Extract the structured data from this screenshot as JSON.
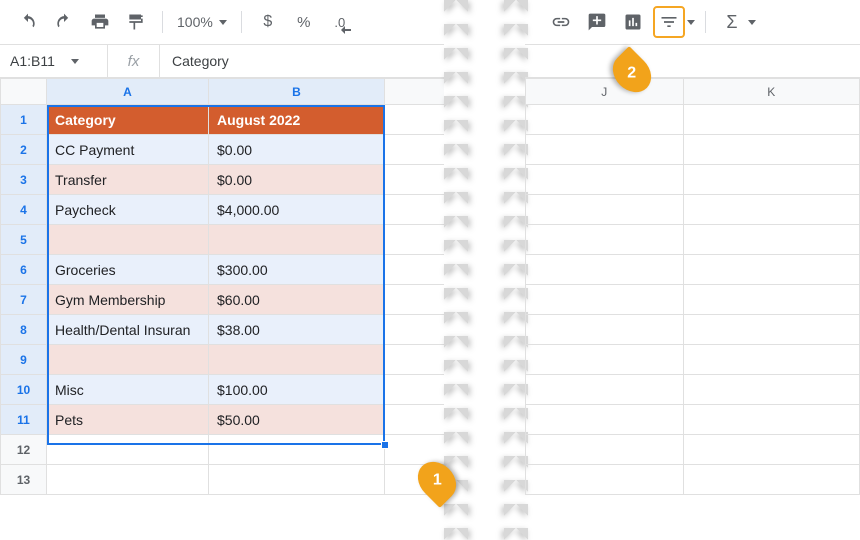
{
  "toolbar": {
    "zoom": "100%",
    "currency": "$",
    "percent": "%",
    "decimal": ".0"
  },
  "namebox": {
    "range": "A1:B11",
    "fx": "fx",
    "formula": "Category"
  },
  "columns_left": [
    "A",
    "B"
  ],
  "columns_right": [
    "J",
    "K"
  ],
  "rows": [
    "1",
    "2",
    "3",
    "4",
    "5",
    "6",
    "7",
    "8",
    "9",
    "10",
    "11",
    "12",
    "13"
  ],
  "header": {
    "a": "Category",
    "b": "August 2022"
  },
  "data": [
    {
      "a": "CC Payment",
      "b": "$0.00",
      "tone": "blue"
    },
    {
      "a": "Transfer",
      "b": "$0.00",
      "tone": "pink"
    },
    {
      "a": "Paycheck",
      "b": "$4,000.00",
      "tone": "blue"
    },
    {
      "a": "",
      "b": "",
      "tone": "pink"
    },
    {
      "a": "Groceries",
      "b": "$300.00",
      "tone": "blue"
    },
    {
      "a": "Gym Membership",
      "b": "$60.00",
      "tone": "pink"
    },
    {
      "a": "Health/Dental Insuran",
      "b": "$38.00",
      "tone": "blue"
    },
    {
      "a": "",
      "b": "",
      "tone": "pink"
    },
    {
      "a": "Misc",
      "b": "$100.00",
      "tone": "blue"
    },
    {
      "a": "Pets",
      "b": "$50.00",
      "tone": "pink"
    }
  ],
  "callouts": {
    "one": "1",
    "two": "2"
  },
  "sigma": "Σ"
}
